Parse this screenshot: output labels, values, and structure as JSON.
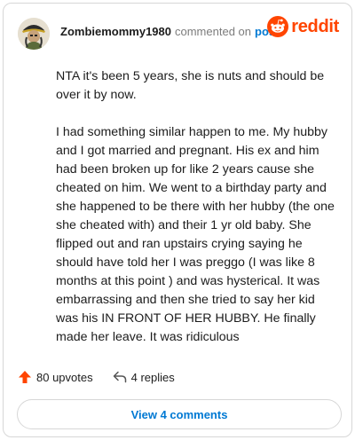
{
  "comment": {
    "username": "Zombiemommy1980",
    "commented_on": "commented on",
    "post_link": "post",
    "paragraphs": [
      "NTA it's been 5 years, she is nuts and should be over it by now.",
      "I had something similar happen to me. My hubby and I got married and pregnant. His ex and him had been broken up for like 2 years cause she cheated on him. We went to a birthday party and she happened to be there with her hubby (the one she cheated with) and their 1 yr old baby. She flipped out and ran upstairs crying saying he should have told her I was preggo (I was like 8 months at this point ) and was hysterical. It was embarrassing and then she tried to say her kid was his IN FRONT OF HER HUBBY. He finally made her leave. It was ridiculous"
    ]
  },
  "brand": {
    "logo_text": "reddit",
    "color": "#ff4500"
  },
  "actions": {
    "upvotes": "80 upvotes",
    "replies": "4 replies",
    "upvote_color": "#ff4500"
  },
  "view_button": {
    "label": "View 4 comments",
    "color": "#0079d3"
  },
  "icons": [
    "avatar",
    "reddit-logo-icon",
    "upvote-arrow-icon",
    "reply-arrow-icon"
  ]
}
